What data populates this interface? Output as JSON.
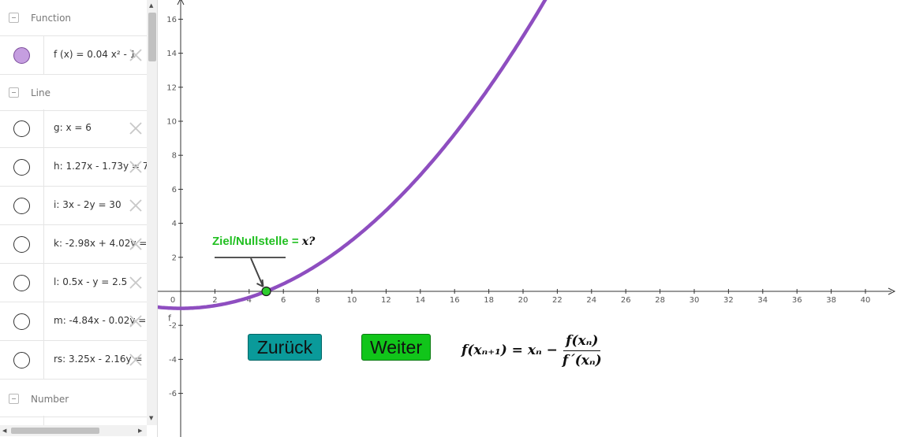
{
  "algebra": {
    "groups": [
      {
        "label": "Function"
      },
      {
        "label": "Line"
      },
      {
        "label": "Number"
      }
    ],
    "function_row": {
      "expr": "f (x)  =  0.04 x² - 1",
      "color": "#c59ee0"
    },
    "lines": [
      {
        "expr": "g: x = 6"
      },
      {
        "expr": "h: 1.27x - 1.73y = 7"
      },
      {
        "expr": "i: 3x - 2y = 30"
      },
      {
        "expr": "k: -2.98x + 4.02y ="
      },
      {
        "expr": "l: 0.5x - y = 2.5"
      },
      {
        "expr": "m: -4.84x - 0.02y ="
      },
      {
        "expr": "rs: 3.25x - 2.16y ="
      }
    ]
  },
  "graphics": {
    "x_ticks": [
      "0",
      "2",
      "4",
      "6",
      "8",
      "10",
      "12",
      "14",
      "16",
      "18",
      "20",
      "22",
      "24",
      "26",
      "28",
      "30",
      "32",
      "34",
      "36",
      "38",
      "40"
    ],
    "y_ticks_pos": [
      "2",
      "4",
      "6",
      "8",
      "10",
      "12",
      "14",
      "16"
    ],
    "y_ticks_neg": [
      "-2",
      "-4",
      "-6"
    ],
    "curve_label": "f",
    "curve_color": "#8e4ec0",
    "point_color": "#2ecc2e",
    "target_label": "Ziel/Nullstelle =",
    "target_var": "x?",
    "buttons": {
      "back": "Zurück",
      "next": "Weiter"
    },
    "formula": {
      "lhs": "f(xₙ₊₁) = xₙ −",
      "numerator": "f(xₙ)",
      "denominator": "f´(xₙ)"
    }
  }
}
